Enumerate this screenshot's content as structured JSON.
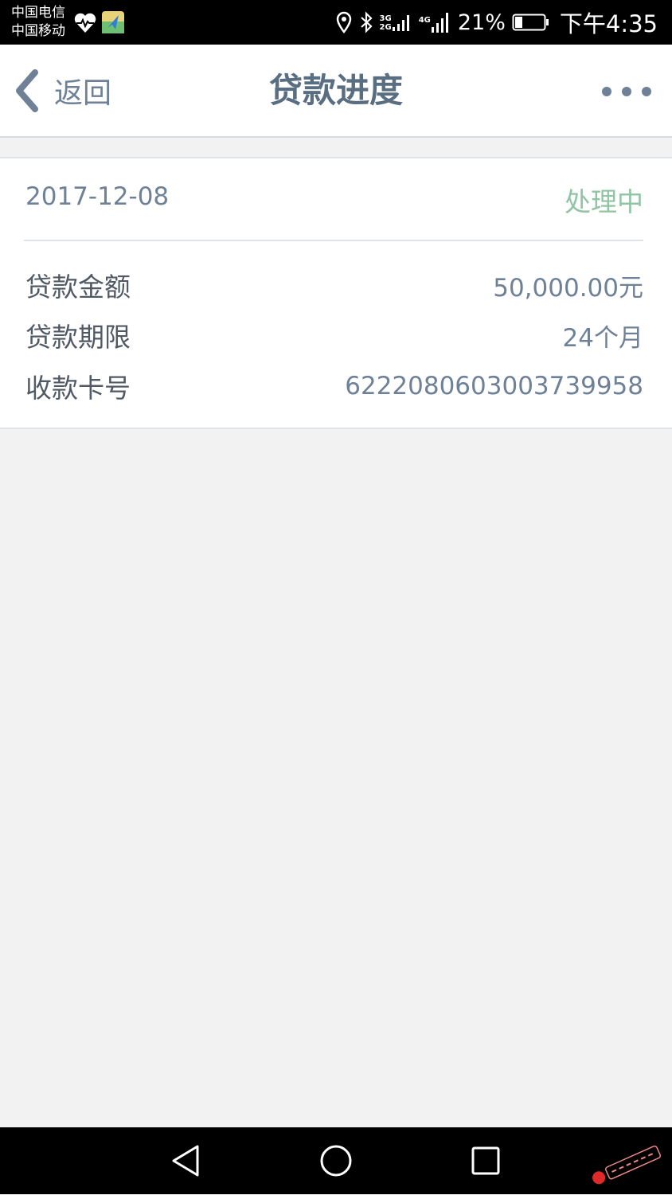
{
  "status_bar": {
    "carrier_1": "中国电信",
    "carrier_2": "中国移动",
    "signal_labels": [
      "3G",
      "2G",
      "4G"
    ],
    "battery_percent": "21%",
    "time": "下午4:35"
  },
  "nav": {
    "back_label": "返回",
    "title": "贷款进度"
  },
  "loan": {
    "date": "2017-12-08",
    "status": "处理中",
    "rows": [
      {
        "label": "贷款金额",
        "value": "50,000.00元"
      },
      {
        "label": "贷款期限",
        "value": "24个月"
      },
      {
        "label": "收款卡号",
        "value": "6222080603003739958"
      }
    ]
  },
  "colors": {
    "accent": "#6e8196",
    "status_green": "#8fc5a3",
    "background": "#f2f2f2"
  }
}
